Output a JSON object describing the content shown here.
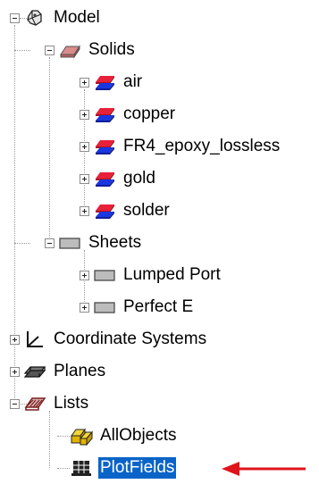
{
  "tree": {
    "model": {
      "label": "Model",
      "icon": "model-icon"
    },
    "solids": {
      "label": "Solids",
      "icon": "solid-box-icon"
    },
    "solid_items": [
      {
        "label": "air",
        "icon": "solid-material-icon"
      },
      {
        "label": "copper",
        "icon": "solid-material-icon"
      },
      {
        "label": "FR4_epoxy_lossless",
        "icon": "solid-material-icon"
      },
      {
        "label": "gold",
        "icon": "solid-material-icon"
      },
      {
        "label": "solder",
        "icon": "solid-material-icon"
      }
    ],
    "sheets": {
      "label": "Sheets",
      "icon": "sheet-icon"
    },
    "sheet_items": [
      {
        "label": "Lumped Port",
        "icon": "sheet-icon"
      },
      {
        "label": "Perfect E",
        "icon": "sheet-icon"
      }
    ],
    "coordinate_systems": {
      "label": "Coordinate Systems",
      "icon": "coordinate-axes-icon"
    },
    "planes": {
      "label": "Planes",
      "icon": "planes-icon"
    },
    "lists": {
      "label": "Lists",
      "icon": "lists-icon"
    },
    "list_items": [
      {
        "label": "AllObjects",
        "icon": "all-objects-icon"
      },
      {
        "label": "PlotFields",
        "icon": "plot-fields-icon",
        "selected": true
      }
    ]
  },
  "colors": {
    "selection": "#0a64c8",
    "arrow": "#e0151b",
    "solid_red": "#e8203a",
    "solid_blue": "#1a36e0",
    "sheet_gray": "#bcbcbc"
  }
}
